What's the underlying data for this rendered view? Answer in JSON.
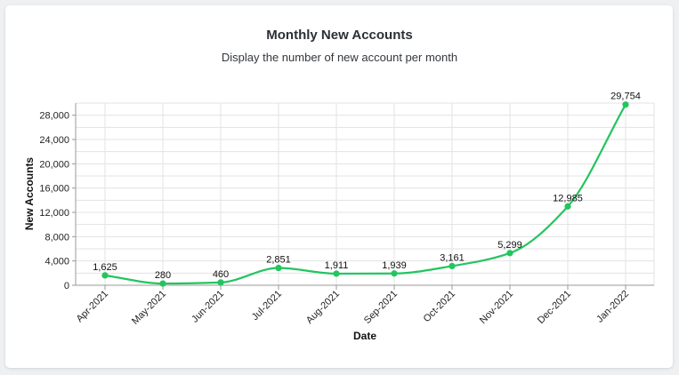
{
  "chart_data": {
    "type": "line",
    "title": "Monthly New Accounts",
    "subtitle": "Display the number of new account per month",
    "xlabel": "Date",
    "ylabel": "New Accounts",
    "categories": [
      "Apr-2021",
      "May-2021",
      "Jun-2021",
      "Jul-2021",
      "Aug-2021",
      "Sep-2021",
      "Oct-2021",
      "Nov-2021",
      "Dec-2021",
      "Jan-2022"
    ],
    "series": [
      {
        "values": [
          1625,
          280,
          460,
          2851,
          1911,
          1939,
          3161,
          5299,
          12985,
          29754
        ],
        "labels": [
          "1,625",
          "280",
          "460",
          "2,851",
          "1,911",
          "1,939",
          "3,161",
          "5,299",
          "12,985",
          "29,754"
        ]
      }
    ],
    "yticks": [
      0,
      4000,
      8000,
      12000,
      16000,
      20000,
      24000,
      28000
    ],
    "ytick_labels": [
      "0",
      "4,000",
      "8,000",
      "12,000",
      "16,000",
      "20,000",
      "24,000",
      "28,000"
    ],
    "ylim": [
      0,
      30000
    ],
    "grid": true,
    "line_color": "#22c55e"
  }
}
